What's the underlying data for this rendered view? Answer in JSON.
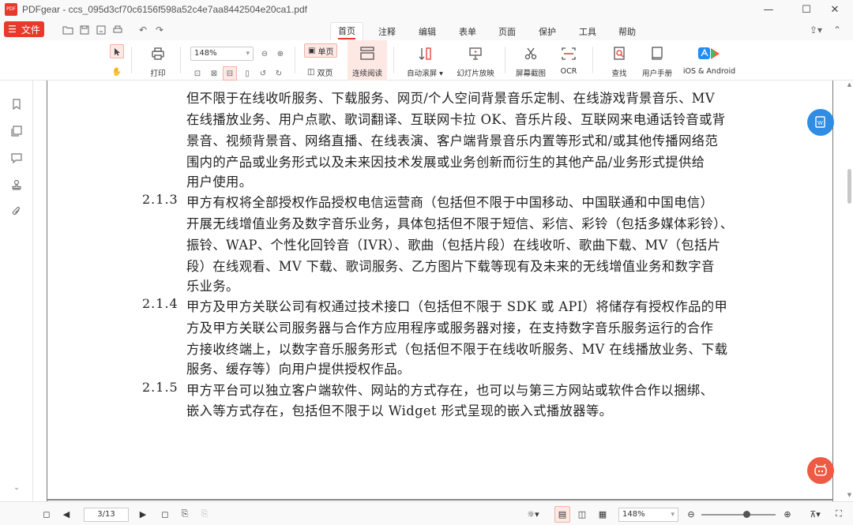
{
  "window": {
    "app_name": "PDFgear",
    "title": "PDFgear - ccs_095d3cf70c6156f598a52c4e7aa8442504e20ca1.pdf",
    "logo_text": "PDF",
    "controls": [
      "—",
      "☐",
      "✕"
    ]
  },
  "menu": {
    "file_label": "文件",
    "tabs": [
      "首页",
      "注释",
      "编辑",
      "表单",
      "页面",
      "保护",
      "工具",
      "帮助"
    ],
    "active_tab": "首页"
  },
  "toolbar": {
    "print_label": "打印",
    "zoom_value": "148%",
    "single_page_label": "单页",
    "double_page_label": "双页",
    "continuous_label": "连续阅读",
    "auto_scroll_label": "自动滚屏",
    "slideshow_label": "幻灯片放映",
    "screenshot_label": "屏幕截图",
    "ocr_label": "OCR",
    "search_label": "查找",
    "manual_label": "用户手册",
    "ios_android_label": "iOS & Android"
  },
  "document": {
    "lines": [
      "但不限于在线收听服务、下载服务、网页/个人空间背景音乐定制、在线游戏背景音乐、MV",
      "在线播放业务、用户点歌、歌词翻译、互联网卡拉 OK、音乐片段、互联网来电通话铃音或背",
      "景音、视频背景音、网络直播、在线表演、客户端背景音乐内置等形式和/或其他传播网络范",
      "围内的产品或业务形式以及未来因技术发展或业务创新而衍生的其他产品/业务形式提供给",
      "用户使用。",
      "甲方有权将全部授权作品授权电信运营商（包括但不限于中国移动、中国联通和中国电信）",
      "开展无线增值业务及数字音乐业务，具体包括但不限于短信、彩信、彩铃（包括多媒体彩铃）、",
      "振铃、WAP、个性化回铃音（IVR）、歌曲（包括片段）在线收听、歌曲下载、MV（包括片",
      "段）在线观看、MV 下载、歌词服务、乙方图片下载等现有及未来的无线增值业务和数字音",
      "乐业务。",
      "甲方及甲方关联公司有权通过技术接口（包括但不限于 SDK 或 API）将储存有授权作品的甲",
      "方及甲方关联公司服务器与合作方应用程序或服务器对接，在支持数字音乐服务运行的合作",
      "方接收终端上，以数字音乐服务形式（包括但不限于在线收听服务、MV 在线播放业务、下载",
      "服务、缓存等）向用户提供授权作品。",
      "甲方平台可以独立客户端软件、网站的方式存在，也可以与第三方网站或软件合作以捆绑、",
      "嵌入等方式存在，包括但不限于以 Widget 形式呈现的嵌入式播放器等。"
    ],
    "clauses": [
      "2.1.3",
      "2.1.4",
      "2.1.5"
    ]
  },
  "status": {
    "page_indicator": "3/13",
    "zoom_value": "148%"
  },
  "colors": {
    "accent": "#e8392d",
    "accent_light": "#fde8e4",
    "float_blue": "#2f8de4",
    "float_red": "#ee5a44"
  }
}
